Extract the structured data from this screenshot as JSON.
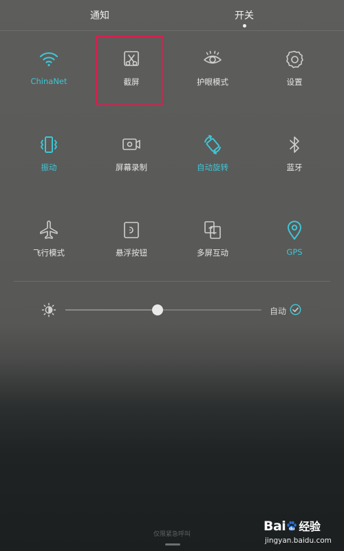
{
  "header": {
    "tabs": [
      {
        "label": "通知",
        "selected": false
      },
      {
        "label": "开关",
        "selected": true
      }
    ]
  },
  "toggles": [
    {
      "label": "ChinaNet",
      "icon": "wifi-icon",
      "active": true
    },
    {
      "label": "截屏",
      "icon": "screenshot-icon",
      "active": false,
      "highlighted": true
    },
    {
      "label": "护眼模式",
      "icon": "eye-icon",
      "active": false
    },
    {
      "label": "设置",
      "icon": "gear-icon",
      "active": false
    },
    {
      "label": "振动",
      "icon": "vibrate-icon",
      "active": true
    },
    {
      "label": "屏幕录制",
      "icon": "screen-record-icon",
      "active": false
    },
    {
      "label": "自动旋转",
      "icon": "auto-rotate-icon",
      "active": true
    },
    {
      "label": "蓝牙",
      "icon": "bluetooth-icon",
      "active": false
    },
    {
      "label": "飞行模式",
      "icon": "airplane-icon",
      "active": false
    },
    {
      "label": "悬浮按钮",
      "icon": "floating-button-icon",
      "active": false
    },
    {
      "label": "多屏互动",
      "icon": "multi-screen-icon",
      "active": false
    },
    {
      "label": "GPS",
      "icon": "location-pin-icon",
      "active": true
    }
  ],
  "brightness": {
    "icon": "brightness-icon",
    "level_percent": 47,
    "auto_label": "自动",
    "auto_checked": true
  },
  "footer": {
    "emergency_text": "仅限紧急呼叫"
  },
  "watermark": {
    "logo_text": "Bai",
    "logo_text_2": "经验",
    "url": "jingyan.baidu.com"
  },
  "colors": {
    "accent": "#3ec6d6",
    "inactive_icon": "#cfcfcf",
    "highlight_box": "#d6204e"
  }
}
